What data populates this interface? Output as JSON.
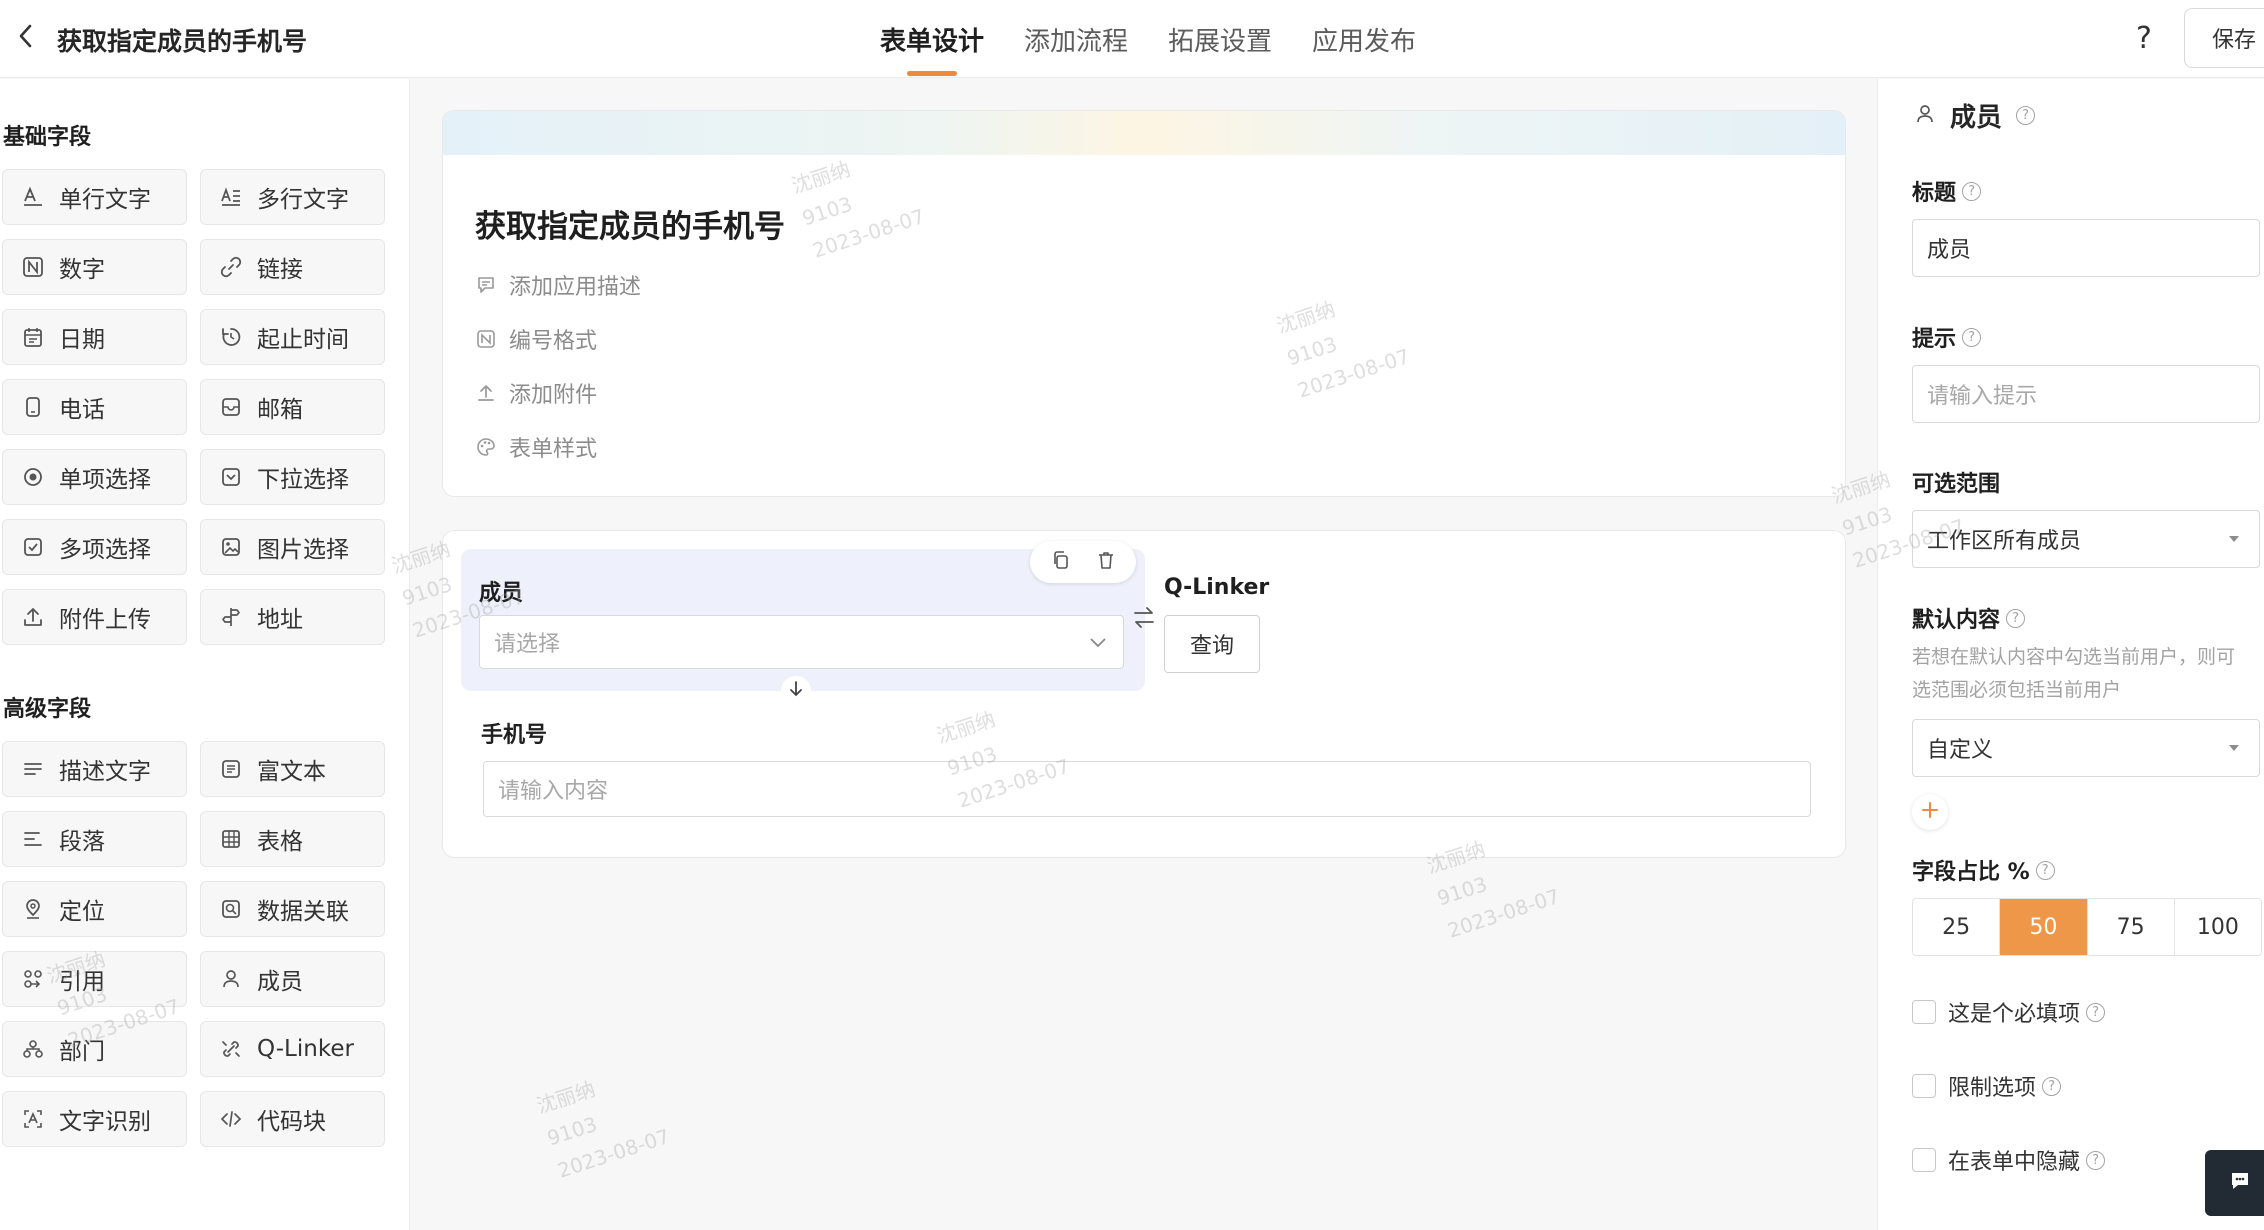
{
  "header": {
    "title": "获取指定成员的手机号",
    "tabs": [
      {
        "label": "表单设计",
        "active": true
      },
      {
        "label": "添加流程",
        "active": false
      },
      {
        "label": "拓展设置",
        "active": false
      },
      {
        "label": "应用发布",
        "active": false
      }
    ],
    "help_label": "?",
    "save_label": "保存"
  },
  "left_panel": {
    "basic_title": "基础字段",
    "basic_fields": [
      {
        "label": "单行文字",
        "icon": "single-line-text-icon"
      },
      {
        "label": "多行文字",
        "icon": "multi-line-text-icon"
      },
      {
        "label": "数字",
        "icon": "number-icon"
      },
      {
        "label": "链接",
        "icon": "link-icon"
      },
      {
        "label": "日期",
        "icon": "calendar-icon"
      },
      {
        "label": "起止时间",
        "icon": "time-range-icon"
      },
      {
        "label": "电话",
        "icon": "phone-icon"
      },
      {
        "label": "邮箱",
        "icon": "mailbox-icon"
      },
      {
        "label": "单项选择",
        "icon": "radio-icon"
      },
      {
        "label": "下拉选择",
        "icon": "dropdown-icon"
      },
      {
        "label": "多项选择",
        "icon": "checkbox-icon"
      },
      {
        "label": "图片选择",
        "icon": "image-icon"
      },
      {
        "label": "附件上传",
        "icon": "upload-icon"
      },
      {
        "label": "地址",
        "icon": "address-icon"
      }
    ],
    "advanced_title": "高级字段",
    "advanced_fields": [
      {
        "label": "描述文字",
        "icon": "description-icon"
      },
      {
        "label": "富文本",
        "icon": "rich-text-icon"
      },
      {
        "label": "段落",
        "icon": "paragraph-icon"
      },
      {
        "label": "表格",
        "icon": "table-icon"
      },
      {
        "label": "定位",
        "icon": "location-icon"
      },
      {
        "label": "数据关联",
        "icon": "data-link-icon"
      },
      {
        "label": "引用",
        "icon": "reference-icon"
      },
      {
        "label": "成员",
        "icon": "member-icon"
      },
      {
        "label": "部门",
        "icon": "department-icon"
      },
      {
        "label": "Q-Linker",
        "icon": "qlinker-icon"
      },
      {
        "label": "文字识别",
        "icon": "ocr-icon"
      },
      {
        "label": "代码块",
        "icon": "code-icon"
      }
    ]
  },
  "canvas": {
    "form_title": "获取指定成员的手机号",
    "meta": [
      {
        "label": "添加应用描述",
        "icon": "comment-icon"
      },
      {
        "label": "编号格式",
        "icon": "number-format-icon"
      },
      {
        "label": "添加附件",
        "icon": "attachment-upload-icon"
      },
      {
        "label": "表单样式",
        "icon": "palette-icon"
      }
    ],
    "member_field": {
      "label": "成员",
      "placeholder": "请选择"
    },
    "qlinker": {
      "label": "Q-Linker",
      "button": "查询"
    },
    "phone_field": {
      "label": "手机号",
      "placeholder": "请输入内容"
    }
  },
  "right_panel": {
    "field_name": "成员",
    "title_label": "标题",
    "title_value": "成员",
    "hint_label": "提示",
    "hint_placeholder": "请输入提示",
    "range_label": "可选范围",
    "range_value": "工作区所有成员",
    "default_label": "默认内容",
    "default_desc": "若想在默认内容中勾选当前用户，则可选范围必须包括当前用户",
    "default_value": "自定义",
    "ratio_label": "字段占比 %",
    "ratio_options": [
      "25",
      "50",
      "75",
      "100"
    ],
    "ratio_selected": "50",
    "checkboxes": [
      {
        "label": "这是个必填项",
        "checked": false
      },
      {
        "label": "限制选项",
        "checked": false
      },
      {
        "label": "在表单中隐藏",
        "checked": false
      }
    ]
  },
  "watermark": {
    "name": "沈丽纳",
    "id": "9103",
    "date": "2023-08-07"
  },
  "colors": {
    "accent": "#ee8a3c",
    "ratio_selected_bg": "#ee9748",
    "member_block_bg": "#eef1fb"
  }
}
